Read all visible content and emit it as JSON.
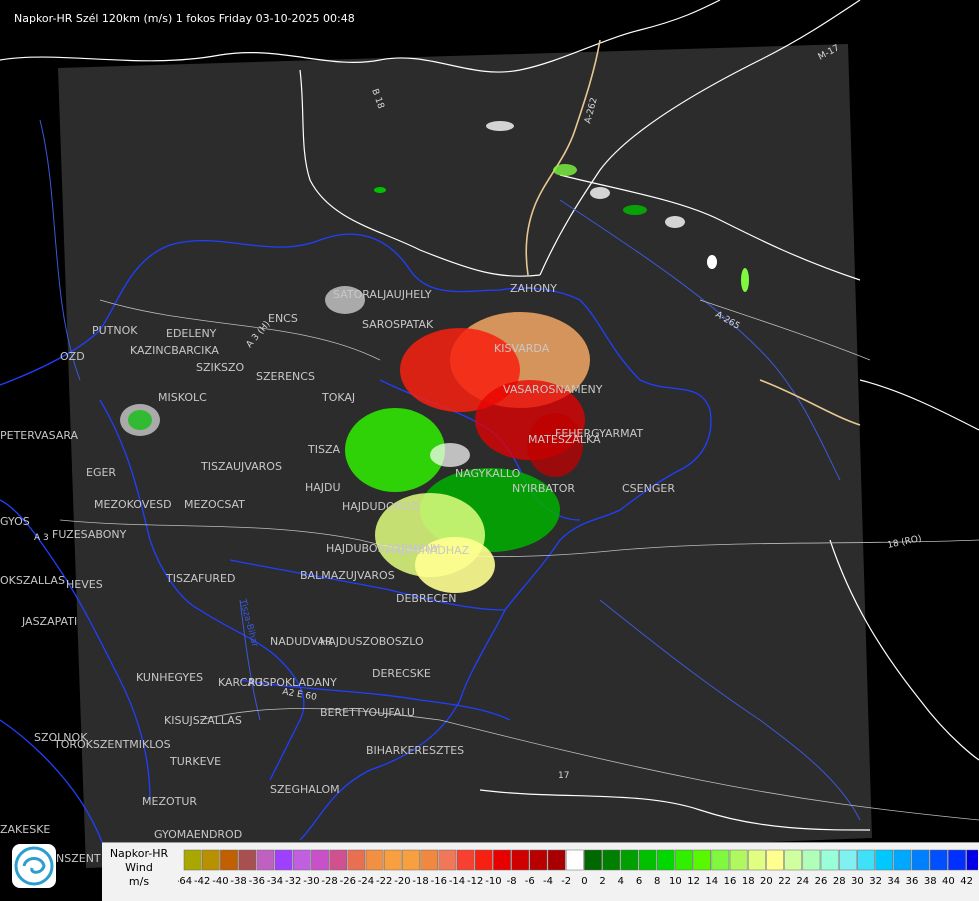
{
  "title": "Napkor-HR Szél 120km (m/s) 1 fokos Friday 03-10-2025 00:48",
  "colors": {
    "background": "#000000",
    "radar_area": "#2c2c2c",
    "borders": "#ffffff",
    "county_borders": "#2040ff",
    "highway": "#e8c890",
    "legend_bg": "#f2f2f2"
  },
  "legend": {
    "line1": "Napkor-HR",
    "line2": "Wind",
    "line3": "m/s",
    "ticks": [
      "-64",
      "-42",
      "-40",
      "-38",
      "-36",
      "-34",
      "-32",
      "-30",
      "-28",
      "-26",
      "-24",
      "-22",
      "-20",
      "-18",
      "-16",
      "-14",
      "-12",
      "-10",
      "-8",
      "-6",
      "-4",
      "-2",
      "0",
      "2",
      "4",
      "6",
      "8",
      "10",
      "12",
      "14",
      "16",
      "18",
      "20",
      "22",
      "24",
      "26",
      "28",
      "30",
      "32",
      "34",
      "36",
      "38",
      "40",
      "42"
    ],
    "swatches": [
      "#a8a800",
      "#b89000",
      "#c06000",
      "#a85050",
      "#c060c0",
      "#a040ff",
      "#c060e0",
      "#c850c8",
      "#d05090",
      "#e87050",
      "#f09040",
      "#f8a040",
      "#f8a040",
      "#f08840",
      "#f07858",
      "#f84030",
      "#f82010",
      "#e80000",
      "#d00000",
      "#b80000",
      "#a80000",
      "#ffffff",
      "#006800",
      "#008000",
      "#00a000",
      "#00c000",
      "#00d800",
      "#30f000",
      "#58f800",
      "#80f840",
      "#b0f860",
      "#e0ff80",
      "#ffff90",
      "#d0ffa0",
      "#b0ffb8",
      "#98ffd8",
      "#80f0f0",
      "#40e0f8",
      "#00c8ff",
      "#00a8ff",
      "#0080ff",
      "#0050ff",
      "#0030ff",
      "#0000e8"
    ]
  },
  "towns": [
    {
      "name": "SATORALJAUJHELY"
    },
    {
      "name": "ZAHONY"
    },
    {
      "name": "SAROSPATAK"
    },
    {
      "name": "PUTNOK"
    },
    {
      "name": "EDELENY"
    },
    {
      "name": "KAZINCBARCIKA"
    },
    {
      "name": "SZIKSZO"
    },
    {
      "name": "ENCS"
    },
    {
      "name": "SZERENCS"
    },
    {
      "name": "KISVARDA"
    },
    {
      "name": "VASAROSNAMENY"
    },
    {
      "name": "OZD"
    },
    {
      "name": "MISKOLC"
    },
    {
      "name": "TOKAJ"
    },
    {
      "name": "PETERVASARA"
    },
    {
      "name": "FEHERGYARMAT"
    },
    {
      "name": "MATESZALKA"
    },
    {
      "name": "EGER"
    },
    {
      "name": "TISZAUJVAROS"
    },
    {
      "name": "TISZA"
    },
    {
      "name": "NAGYKALLO"
    },
    {
      "name": "NYIRBATOR"
    },
    {
      "name": "CSENGER"
    },
    {
      "name": "HAJDU"
    },
    {
      "name": "MEZOKOVESD"
    },
    {
      "name": "MEZOCSAT"
    },
    {
      "name": "HAJDUDOROG"
    },
    {
      "name": "GYOS"
    },
    {
      "name": "FUZESABONY"
    },
    {
      "name": "HAJDUBOSZORMENY"
    },
    {
      "name": "HAJDUHADHAZ"
    },
    {
      "name": "BALMAZUJVAROS"
    },
    {
      "name": "HEVES"
    },
    {
      "name": "OKSZALLAS"
    },
    {
      "name": "TISZAFURED"
    },
    {
      "name": "DEBRECEN"
    },
    {
      "name": "JASZAPATI"
    },
    {
      "name": "NADUDVAR"
    },
    {
      "name": "HAJDUSZOBOSZLO"
    },
    {
      "name": "DERECSKE"
    },
    {
      "name": "KUNHEGYES"
    },
    {
      "name": "KARCAG"
    },
    {
      "name": "PUSPOKLADANY"
    },
    {
      "name": "BERETTYOUJFALU"
    },
    {
      "name": "KISUJSZALLAS"
    },
    {
      "name": "SZOLNOK"
    },
    {
      "name": "TOROKSZENTMIKLOS"
    },
    {
      "name": "BIHARKERESZTES"
    },
    {
      "name": "TURKEVE"
    },
    {
      "name": "SZEGHALOM"
    },
    {
      "name": "MEZOTUR"
    },
    {
      "name": "GYOMAENDROD"
    },
    {
      "name": "ZAKESKE"
    },
    {
      "name": "NSZENT"
    }
  ],
  "roads": [
    {
      "name": "B 18"
    },
    {
      "name": "A-262"
    },
    {
      "name": "M-17"
    },
    {
      "name": "A 3 (H)"
    },
    {
      "name": "A-265"
    },
    {
      "name": "A 3"
    },
    {
      "name": "18 (RO)"
    },
    {
      "name": "A2 E 60"
    },
    {
      "name": "17"
    }
  ],
  "rivers": [
    {
      "name": "Tisza-Bihar"
    }
  ]
}
